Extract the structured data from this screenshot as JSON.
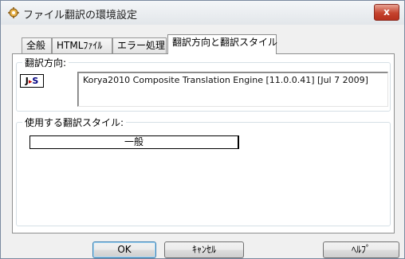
{
  "window": {
    "title": "ファイル翻訳の環境設定",
    "app_icon": "gear-app-icon",
    "close_label": "x"
  },
  "tabs": [
    {
      "label": "全般",
      "active": false
    },
    {
      "label": "HTMLﾌｧｲﾙ",
      "active": false
    },
    {
      "label": "エラー処理",
      "active": false
    },
    {
      "label": "翻訳方向と翻訳スタイル",
      "active": true
    }
  ],
  "direction_group": {
    "title": "翻訳方向:",
    "icon_text": {
      "j": "J",
      "arrow": "▸",
      "s": "S"
    },
    "engine_value": "Korya2010 Composite Translation Engine [11.0.0.41] [Jul  7 2009]"
  },
  "style_group": {
    "title": "使用する翻訳スタイル:",
    "selected_style": "一般"
  },
  "buttons": {
    "ok": "OK",
    "cancel": "ｷｬﾝｾﾙ",
    "help": "ﾍﾙﾌﾟ"
  },
  "colors": {
    "close_button": "#c5432e",
    "accent_default_button": "#3c7fb1",
    "icon_j_s_arrow": "#c00000"
  }
}
